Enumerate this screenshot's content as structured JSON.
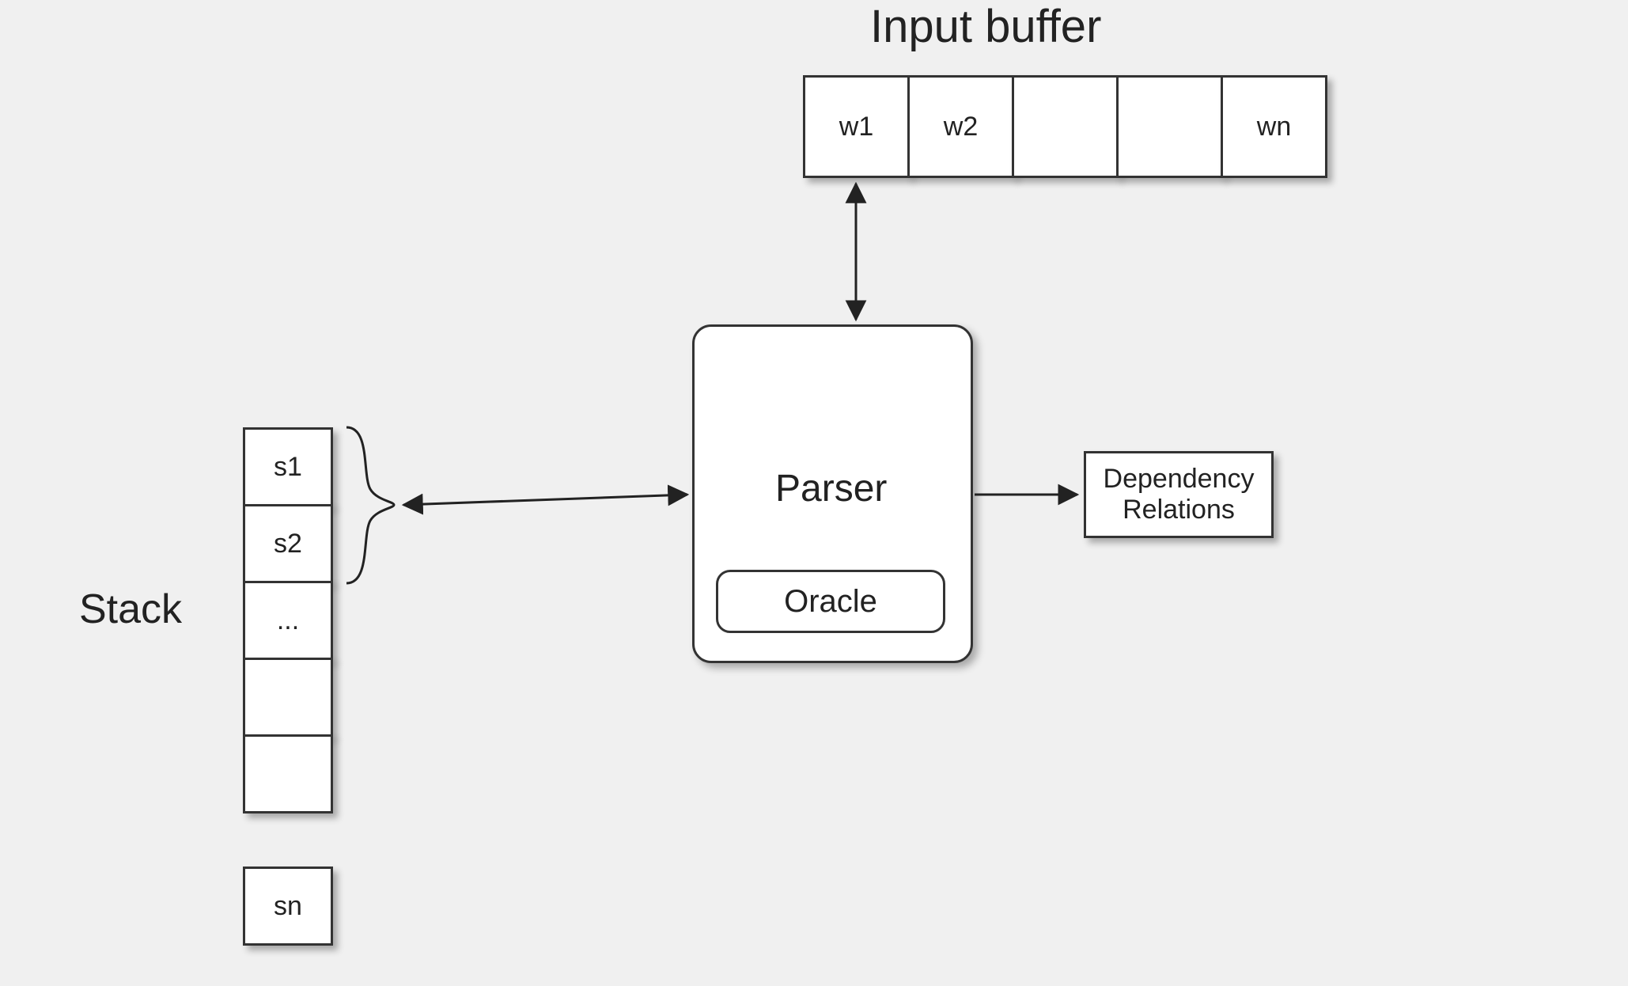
{
  "titles": {
    "input_buffer": "Input buffer",
    "stack": "Stack"
  },
  "input_buffer": {
    "cells": [
      "w1",
      "w2",
      "",
      "",
      "wn"
    ]
  },
  "stack": {
    "cells": [
      "s1",
      "s2",
      "...",
      "",
      "",
      "sn"
    ]
  },
  "parser": {
    "label": "Parser",
    "oracle_label": "Oracle"
  },
  "output": {
    "line1": "Dependency",
    "line2": "Relations"
  }
}
